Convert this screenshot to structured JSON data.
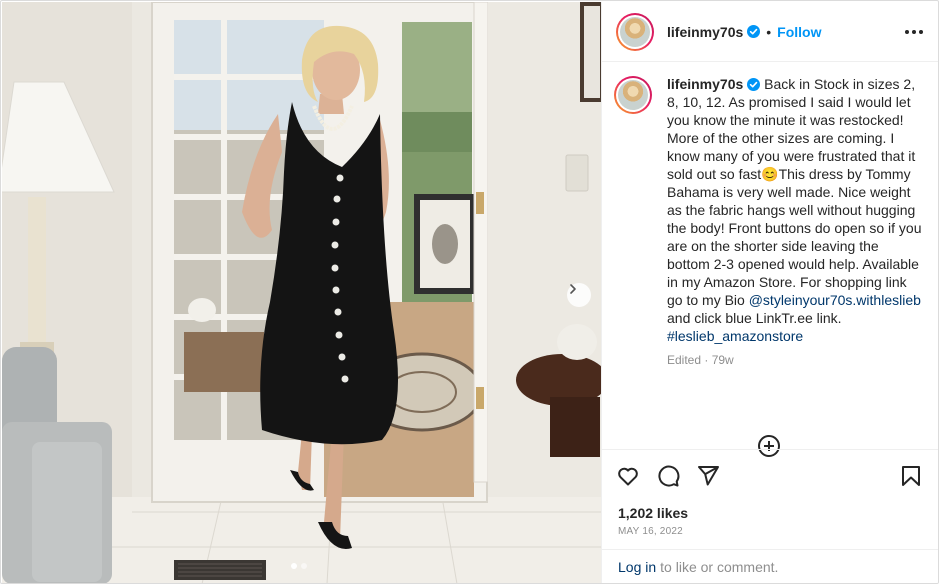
{
  "post": {
    "username": "lifeinmy70s",
    "separator": "•",
    "follow_label": "Follow",
    "caption": {
      "username": "lifeinmy70s",
      "text": "Back in Stock in sizes 2, 8, 10, 12. As promised I said I would let you know the minute it was restocked! More of the other sizes are coming. I know many of you were frustrated that it sold out so fast😊This dress by Tommy Bahama is very well made. Nice weight as the fabric hangs well without hugging the body! Front buttons do open so if you are on the shorter side leaving the bottom 2-3 opened would help. Available in my Amazon Store. For shopping link go to my Bio",
      "mention": "@styleinyour70s.withleslieb",
      "after_mention": "and click blue LinkTr.ee link.",
      "hashtag": "#leslieb_amazonstore"
    },
    "meta": "Edited · 79w",
    "likes": "1,202 likes",
    "date": "May 16, 2022",
    "login_link": "Log in",
    "login_text": "to like or comment."
  },
  "carousel": {
    "slide_count": 2,
    "current_slide": 1
  },
  "icons": {
    "verified": "verified-badge-icon",
    "more": "more-options-icon",
    "next": "chevron-right-icon",
    "add": "add-circle-icon",
    "like": "heart-icon",
    "comment": "comment-icon",
    "share": "paper-plane-icon",
    "save": "bookmark-icon"
  },
  "colors": {
    "accent": "#0095f6",
    "link": "#00376b",
    "muted": "#8e8e8e"
  }
}
